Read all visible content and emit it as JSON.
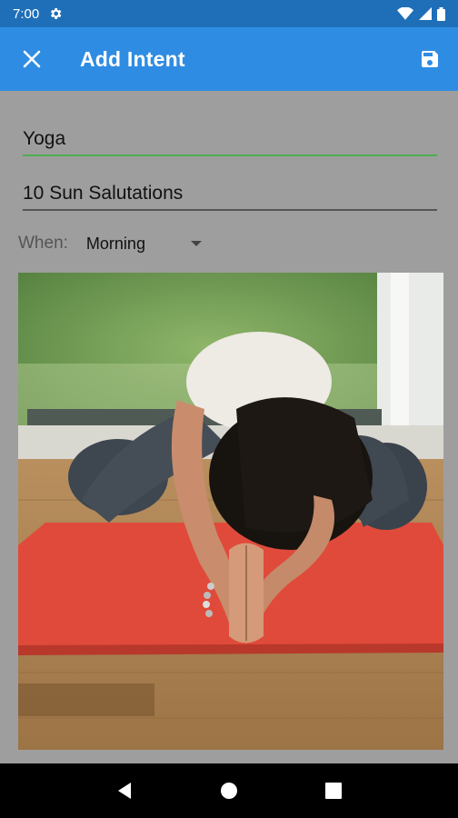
{
  "status_bar": {
    "time": "7:00"
  },
  "app_bar": {
    "title": "Add Intent"
  },
  "form": {
    "name_value": "Yoga",
    "description_value": "10 Sun Salutations",
    "when_label": "When:",
    "when_selected": "Morning"
  },
  "colors": {
    "app_bar": "#2f8ce3",
    "status_bar": "#1f6fb8",
    "accent_line": "#4caf50"
  }
}
